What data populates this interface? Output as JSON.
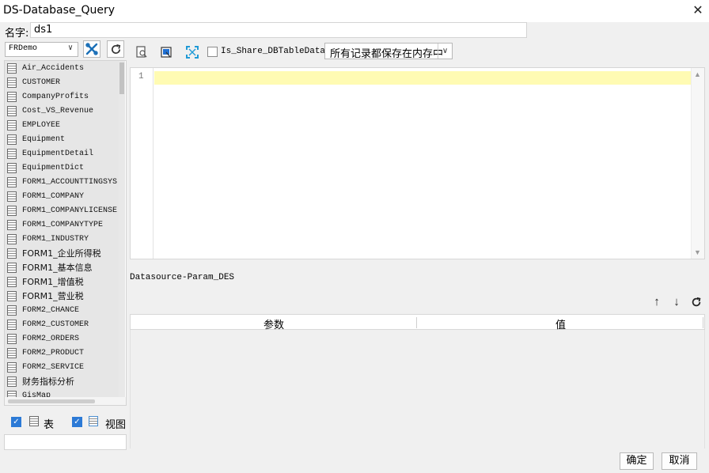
{
  "window": {
    "title": "DS-Database_Query",
    "close_icon": "close-icon"
  },
  "name_field": {
    "label": "名字:",
    "value": "ds1"
  },
  "datasource": {
    "selected": "FRDemo"
  },
  "toolbar": {
    "share_checkbox_label": "Is_Share_DBTableData",
    "share_checked": false,
    "storage_mode": "所有记录都保存在内存中"
  },
  "tables": [
    "Air_Accidents",
    "CUSTOMER",
    "CompanyProfits",
    "Cost_VS_Revenue",
    "EMPLOYEE",
    "Equipment",
    "EquipmentDetail",
    "EquipmentDict",
    "FORM1_ACCOUNTTINGSYS",
    "FORM1_COMPANY",
    "FORM1_COMPANYLICENSE",
    "FORM1_COMPANYTYPE",
    "FORM1_INDUSTRY",
    "FORM1_企业所得税",
    "FORM1_基本信息",
    "FORM1_增值税",
    "FORM1_营业税",
    "FORM2_CHANCE",
    "FORM2_CUSTOMER",
    "FORM2_ORDERS",
    "FORM2_PRODUCT",
    "FORM2_SERVICE",
    "财务指标分析",
    "GisMap"
  ],
  "filters": {
    "table_label": "表",
    "table_checked": true,
    "view_label": "视图",
    "view_checked": true
  },
  "editor": {
    "line_number": "1",
    "content": ""
  },
  "params": {
    "title": "Datasource-Param_DES",
    "columns": [
      "参数",
      "值"
    ]
  },
  "footer": {
    "ok": "确定",
    "cancel": "取消"
  }
}
